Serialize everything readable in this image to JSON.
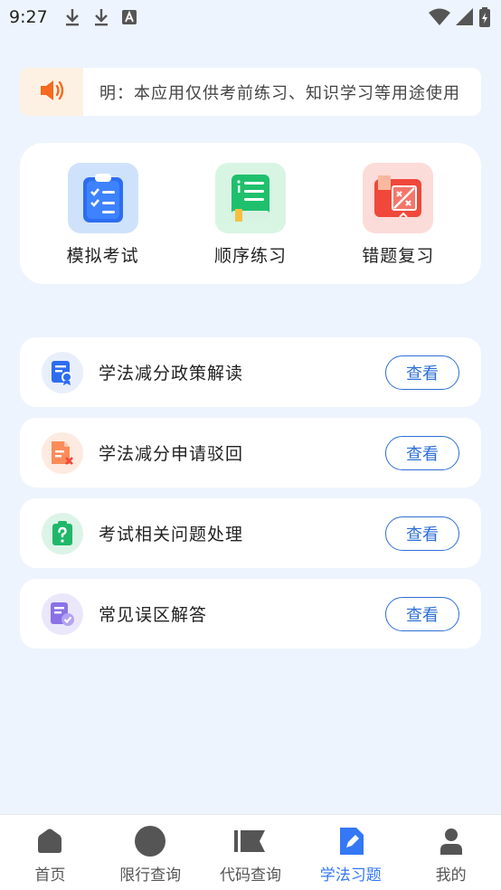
{
  "status_bar": {
    "time": "9:27",
    "icons": [
      "download-icon",
      "download-icon",
      "a-icon",
      "wifi-icon",
      "signal-icon",
      "battery-icon"
    ]
  },
  "notice": {
    "icon": "speaker-icon",
    "text": "明：本应用仅供考前练习、知识学习等用途使用"
  },
  "features": [
    {
      "label": "模拟考试",
      "icon": "clipboard-checklist-icon",
      "bg": "#cfe2fb"
    },
    {
      "label": "顺序练习",
      "icon": "green-book-icon",
      "bg": "#d8f5e4"
    },
    {
      "label": "错题复习",
      "icon": "wrong-questions-book-icon",
      "bg": "#fcdcd9"
    }
  ],
  "rows": [
    {
      "title": "学法减分政策解读",
      "button": "查看",
      "icon": "policy-document-icon"
    },
    {
      "title": "学法减分申请驳回",
      "button": "查看",
      "icon": "rejected-document-icon"
    },
    {
      "title": "考试相关问题处理",
      "button": "查看",
      "icon": "question-clipboard-icon"
    },
    {
      "title": "常见误区解答",
      "button": "查看",
      "icon": "checked-document-icon"
    }
  ],
  "bottom_nav": [
    {
      "label": "首页",
      "icon": "home-icon",
      "active": false
    },
    {
      "label": "限行查询",
      "icon": "circle-icon",
      "active": false
    },
    {
      "label": "代码查询",
      "icon": "flag-icon",
      "active": false
    },
    {
      "label": "学法习题",
      "icon": "edit-icon",
      "active": true
    },
    {
      "label": "我的",
      "icon": "user-icon",
      "active": false
    }
  ],
  "colors": {
    "accent": "#3478f6",
    "button_border": "#2f6fd6",
    "background": "#eef4fd",
    "notice_icon": "#f56a1e"
  }
}
